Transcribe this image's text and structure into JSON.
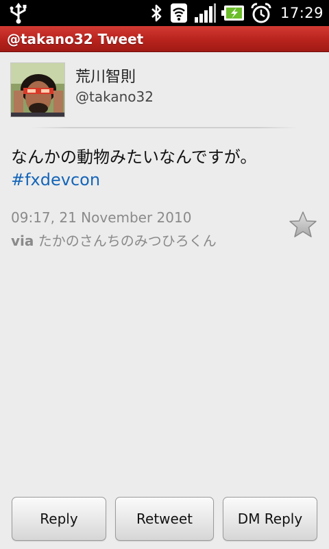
{
  "status_bar": {
    "time": "17:29",
    "icons": [
      "usb-icon",
      "bluetooth-icon",
      "wifi-icon",
      "signal-icon",
      "battery-charging-icon",
      "alarm-icon"
    ]
  },
  "title_bar": {
    "title": "@takano32 Tweet"
  },
  "profile": {
    "display_name": "荒川智則",
    "screen_name": "@takano32"
  },
  "tweet": {
    "text": "なんかの動物みたいなんですが。",
    "hashtag": "#fxdevcon",
    "timestamp": "09:17, 21 November 2010",
    "via_label": "via",
    "source": "たかのさんちのみつひろくん",
    "favorited": false
  },
  "buttons": {
    "reply": "Reply",
    "retweet": "Retweet",
    "dm_reply": "DM Reply"
  },
  "colors": {
    "title_bar": "#b8231d",
    "hashtag": "#1565b8",
    "meta_text": "#8a8a8a",
    "background": "#ececec"
  }
}
